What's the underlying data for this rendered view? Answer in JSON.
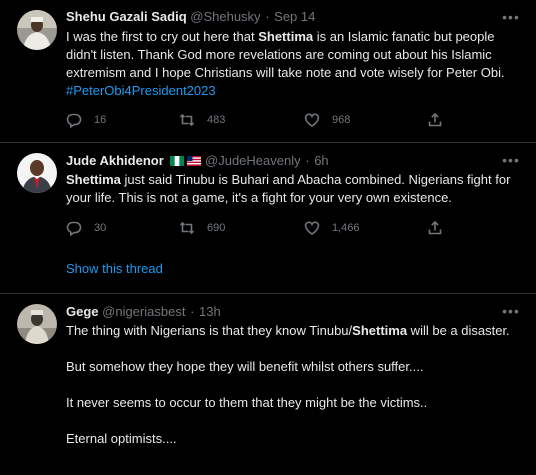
{
  "tweets": [
    {
      "name": "Shehu Gazali Sadiq",
      "handle": "@Shehusky",
      "time": "Sep 14",
      "text_parts": {
        "p1": "I was the first to cry out here that ",
        "p1b": "Shettima",
        "p1c": " is an Islamic fanatic but people didn't listen. Thank God more revelations are coming out about his Islamic extremism and I hope Christians will take note and vote wisely for Peter Obi. ",
        "hashtag": "#PeterObi4President2023"
      },
      "replies": "16",
      "retweets": "483",
      "likes": "968"
    },
    {
      "name": "Jude Akhidenor",
      "handle": "@JudeHeavenly",
      "time": "6h",
      "text_parts": {
        "p1b": "Shettima",
        "p1c": " just said Tinubu is Buhari and Abacha combined. Nigerians fight for your life. This is not a game, it's a fight for your very own existence."
      },
      "replies": "30",
      "retweets": "690",
      "likes": "1,466",
      "show_thread": "Show this thread"
    },
    {
      "name": "Gege",
      "handle": "@nigeriasbest",
      "time": "13h",
      "text_parts": {
        "l1a": "The thing with Nigerians is that they know Tinubu/",
        "l1b": "Shettima",
        "l1c": " will be a disaster.",
        "l2": "But somehow they hope they will benefit whilst others suffer....",
        "l3": "It never seems to occur to them that they might be the victims..",
        "l4": "Eternal optimists...."
      }
    }
  ],
  "colors": {
    "background": "#000000",
    "text": "#e7e9ea",
    "muted": "#71767b",
    "link": "#1d9bf0",
    "divider": "#2f3336"
  },
  "icons": [
    "reply-icon",
    "retweet-icon",
    "like-icon",
    "share-icon",
    "more-icon"
  ]
}
